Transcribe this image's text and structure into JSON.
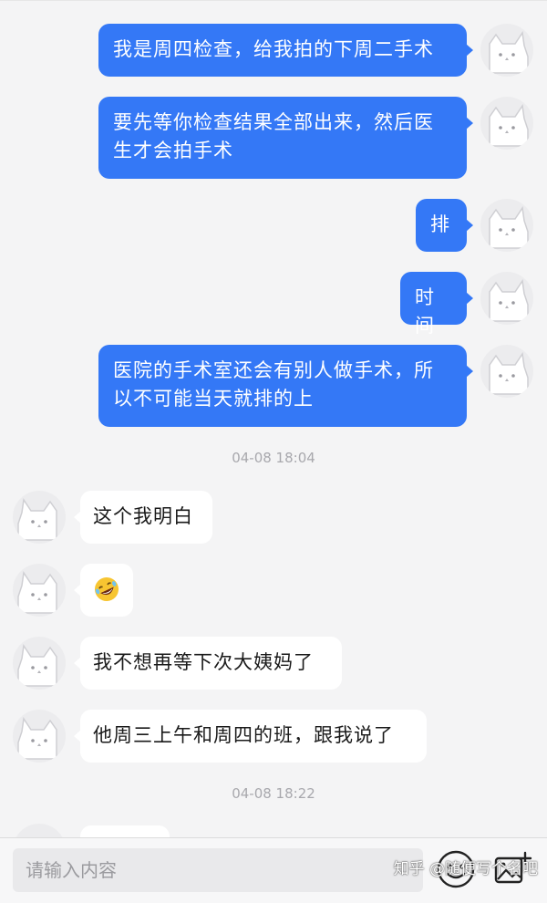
{
  "outgoing_messages": [
    {
      "text": "我是周四检查，给我拍的下周二手术"
    },
    {
      "text": "要先等你检查结果全部出来，然后医生才会拍手术"
    },
    {
      "text": "排"
    },
    {
      "text": "时间"
    },
    {
      "text": "医院的手术室还会有别人做手术，所以不可能当天就排的上"
    }
  ],
  "timestamps": [
    "04-08 18:04",
    "04-08 18:22"
  ],
  "incoming_messages": [
    {
      "text": "这个我明白"
    },
    {
      "text": "",
      "emoji": "rolling-on-floor-laughing-emoji"
    },
    {
      "text": "我不想再等下次大姨妈了"
    },
    {
      "text": "他周三上午和周四的班，跟我说了"
    }
  ],
  "input_bar": {
    "placeholder": "请输入内容",
    "icons": [
      "emoji-face-icon",
      "add-image-icon"
    ]
  },
  "watermark": "知乎 @随便写个名吧",
  "colors": {
    "outgoing_bubble": "#3478f6",
    "incoming_bubble": "#ffffff",
    "background": "#f4f4f5"
  }
}
